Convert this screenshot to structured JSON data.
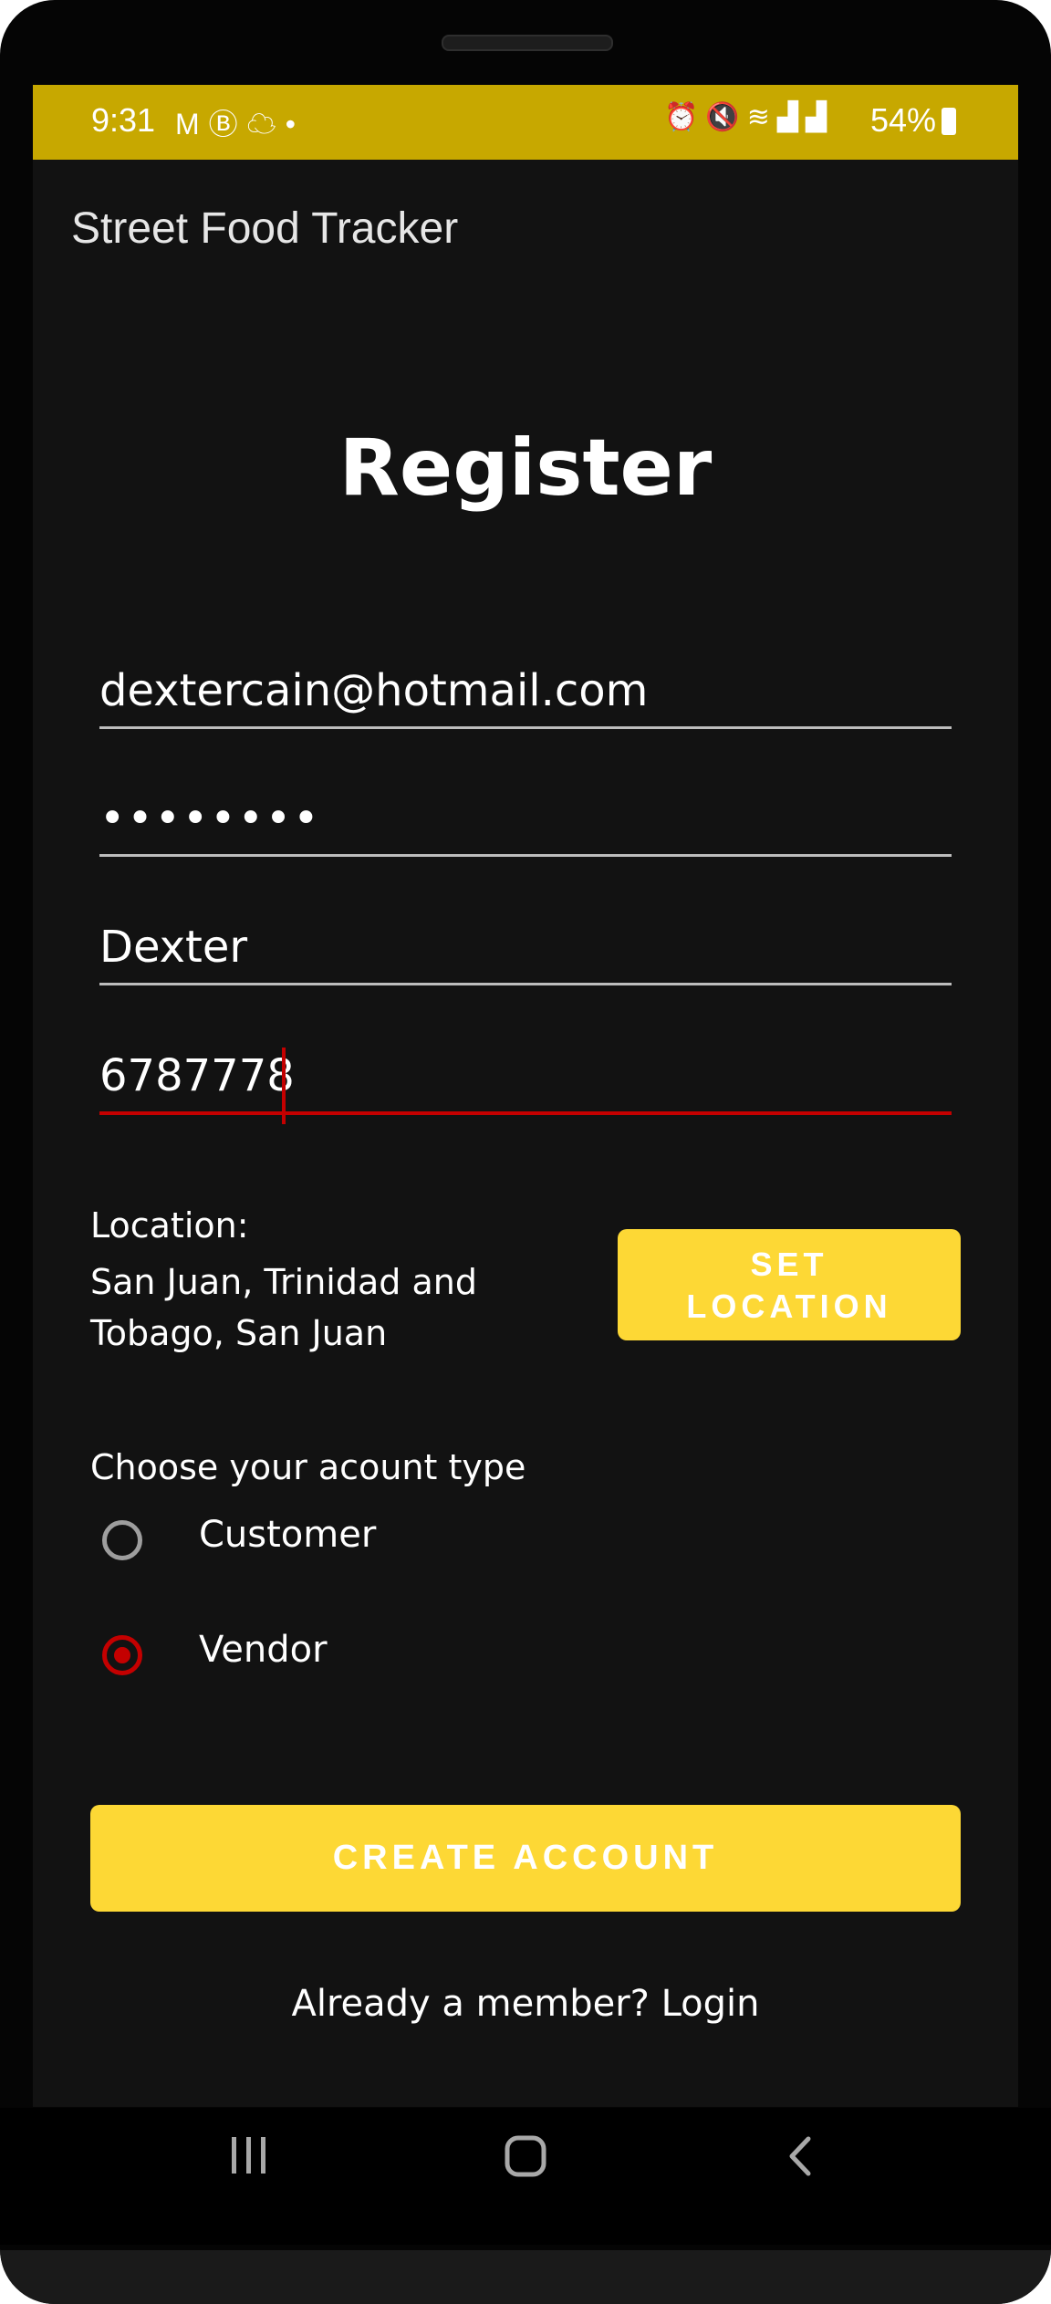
{
  "status_bar": {
    "time": "9:31",
    "left_icons": [
      "gmail-icon",
      "b-badge-icon",
      "cloud-icon",
      "dot-icon"
    ],
    "right_icons": [
      "alarm-icon",
      "mute-icon",
      "wifi-icon",
      "signal-r-icon",
      "signal-icon"
    ],
    "battery": "54%"
  },
  "appbar": {
    "title": "Street Food Tracker"
  },
  "form": {
    "title": "Register",
    "email": "dextercain@hotmail.com",
    "password": "••••••••",
    "name": "Dexter",
    "phone": "6787778",
    "location_label": "Location:",
    "location_value_line1": "San Juan, Trinidad and",
    "location_value_line2": "Tobago, San Juan",
    "set_location_line1": "SET",
    "set_location_line2": "LOCATION",
    "account_type_label": "Choose your acount type",
    "option_customer": "Customer",
    "option_vendor": "Vendor",
    "selected_option": "Vendor",
    "create_account": "CREATE ACCOUNT",
    "login_link": "Already a member? Login"
  },
  "colors": {
    "status_bar": "#c7a800",
    "accent_yellow": "#fdd835",
    "accent_red": "#c40000",
    "background": "#121212"
  }
}
